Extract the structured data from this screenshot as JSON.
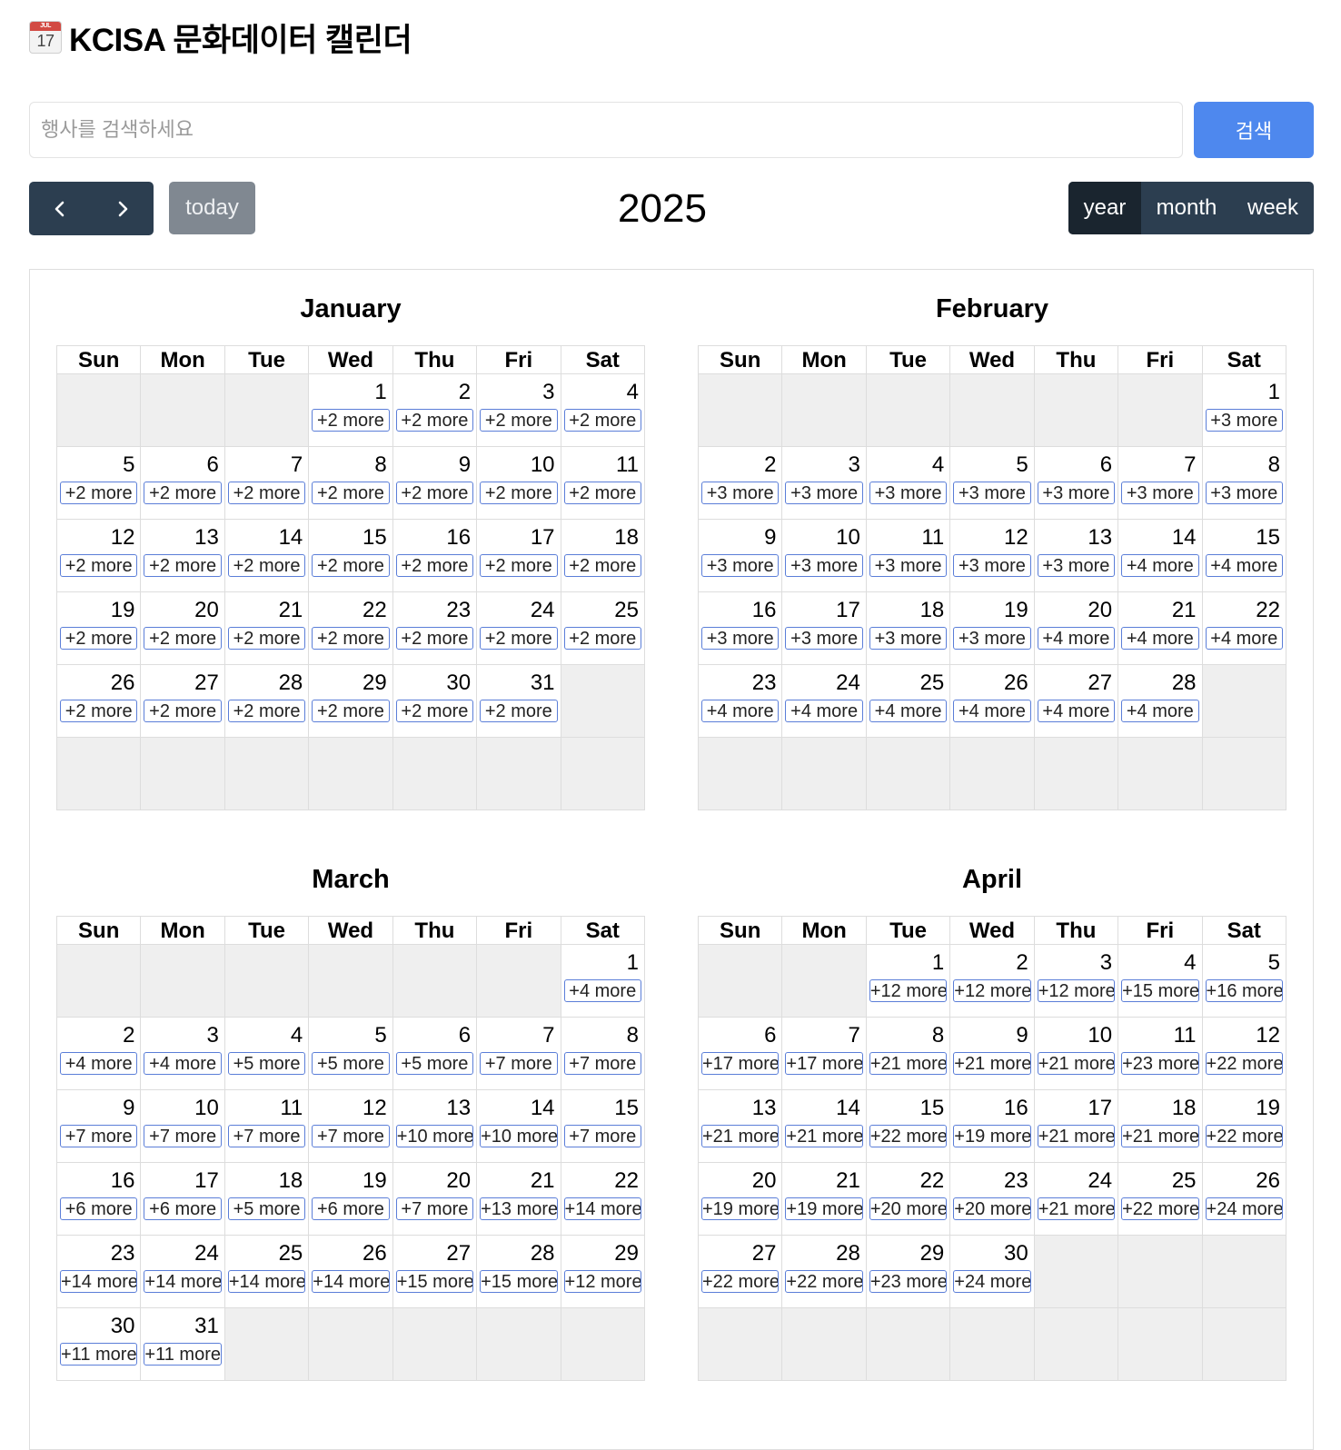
{
  "app": {
    "title": "KCISA 문화데이터 캘린더",
    "icon": "calendar-icon",
    "icon_month": "JUL",
    "icon_day": "17"
  },
  "search": {
    "placeholder": "행사를 검색하세요",
    "value": "",
    "button_label": "검색",
    "button_color": "#4e88ee"
  },
  "toolbar": {
    "prev_icon": "chevron-left-icon",
    "next_icon": "chevron-right-icon",
    "today_label": "today",
    "title": "2025",
    "views": [
      {
        "label": "year",
        "active": true
      },
      {
        "label": "month",
        "active": false
      },
      {
        "label": "week",
        "active": false
      }
    ]
  },
  "calendar": {
    "weekdays": [
      "Sun",
      "Mon",
      "Tue",
      "Wed",
      "Thu",
      "Fri",
      "Sat"
    ],
    "months": [
      {
        "name": "January",
        "first_weekday": 3,
        "days": 31,
        "rows": 6,
        "more": [
          2,
          2,
          2,
          2,
          2,
          2,
          2,
          2,
          2,
          2,
          2,
          2,
          2,
          2,
          2,
          2,
          2,
          2,
          2,
          2,
          2,
          2,
          2,
          2,
          2,
          2,
          2,
          2,
          2,
          2,
          2
        ]
      },
      {
        "name": "February",
        "first_weekday": 6,
        "days": 28,
        "rows": 6,
        "more": [
          3,
          3,
          3,
          3,
          3,
          3,
          3,
          3,
          3,
          3,
          3,
          3,
          3,
          4,
          4,
          3,
          3,
          3,
          3,
          4,
          4,
          4,
          4,
          4,
          4,
          4,
          4,
          4
        ]
      },
      {
        "name": "March",
        "first_weekday": 6,
        "days": 31,
        "rows": 6,
        "more": [
          4,
          4,
          4,
          5,
          5,
          5,
          7,
          7,
          7,
          7,
          7,
          7,
          10,
          10,
          7,
          6,
          6,
          5,
          6,
          7,
          13,
          14,
          14,
          14,
          14,
          14,
          15,
          15,
          12,
          11,
          11
        ]
      },
      {
        "name": "April",
        "first_weekday": 2,
        "days": 30,
        "rows": 6,
        "more": [
          12,
          12,
          12,
          15,
          16,
          17,
          17,
          21,
          21,
          21,
          23,
          22,
          21,
          21,
          22,
          19,
          21,
          21,
          22,
          19,
          19,
          20,
          20,
          21,
          22,
          24,
          22,
          22,
          23,
          24
        ]
      }
    ],
    "more_suffix": "more",
    "colors": {
      "accent": "#5b7ed8",
      "toolbar": "#2c3e50",
      "empty_cell": "#efefef"
    }
  }
}
